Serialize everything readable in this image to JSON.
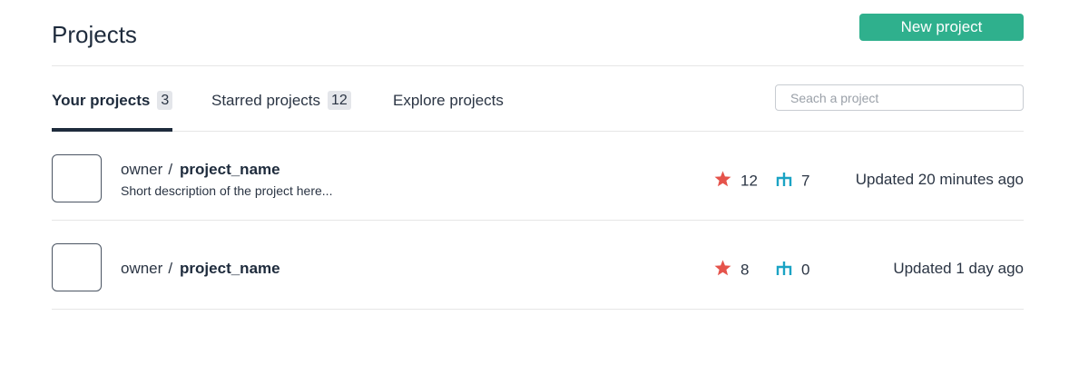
{
  "header": {
    "title": "Projects",
    "new_project_label": "New project"
  },
  "tabs": [
    {
      "label": "Your projects",
      "count": "3"
    },
    {
      "label": "Starred projects",
      "count": "12"
    },
    {
      "label": "Explore projects"
    }
  ],
  "search": {
    "placeholder": "Seach a project"
  },
  "projects": [
    {
      "owner": "owner",
      "separator": "/",
      "name": "project_name",
      "description": "Short description of the project here...",
      "stars": "12",
      "forks": "7",
      "updated": "Updated 20 minutes ago"
    },
    {
      "owner": "owner",
      "separator": "/",
      "name": "project_name",
      "description": "",
      "stars": "8",
      "forks": "0",
      "updated": "Updated 1 day ago"
    }
  ],
  "colors": {
    "accent": "#2fb08d",
    "star": "#e5534b",
    "fork": "#1ba3c4",
    "text": "#1e2b3c"
  },
  "icons": {
    "star": "star-icon",
    "fork": "fork-icon"
  }
}
